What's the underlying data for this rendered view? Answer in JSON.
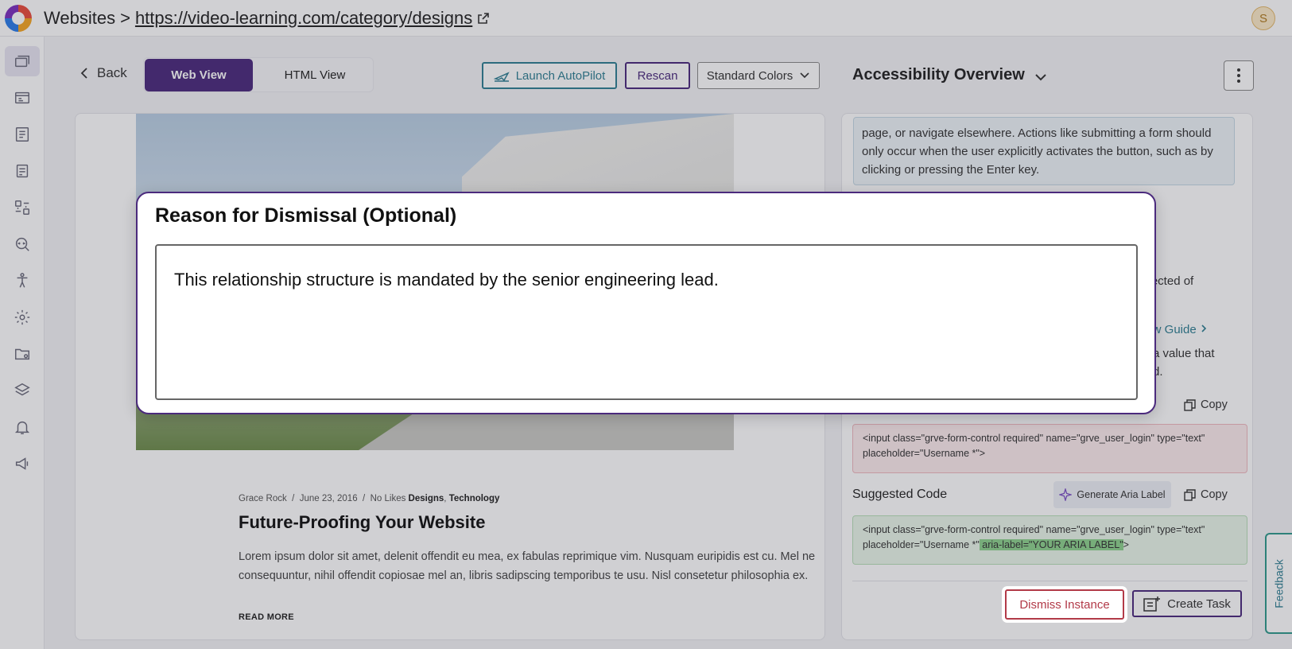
{
  "header": {
    "section": "Websites",
    "separator": ">",
    "url": "https://video-learning.com/category/designs",
    "avatar_initial": "S"
  },
  "sidebar": {
    "items": [
      {
        "icon": "pages-icon",
        "active": true
      },
      {
        "icon": "id-card-icon"
      },
      {
        "icon": "report-icon"
      },
      {
        "icon": "document-icon"
      },
      {
        "icon": "scan-icon"
      },
      {
        "icon": "search-code-icon"
      },
      {
        "icon": "accessibility-icon"
      },
      {
        "icon": "gear-icon"
      },
      {
        "icon": "folder-icon"
      },
      {
        "icon": "layers-icon"
      },
      {
        "icon": "bell-icon"
      },
      {
        "icon": "megaphone-icon"
      }
    ]
  },
  "toolbar": {
    "back_label": "Back",
    "web_view_label": "Web View",
    "html_view_label": "HTML View",
    "autopilot_label": "Launch AutoPilot",
    "rescan_label": "Rescan",
    "colors_label": "Standard Colors"
  },
  "preview": {
    "meta_author": "Grace Rock",
    "meta_sep": "/",
    "meta_date": "June 23, 2016",
    "meta_likes": "No Likes",
    "meta_cat1": "Designs",
    "meta_comma": ",",
    "meta_cat2": "Technology",
    "post_title": "Future-Proofing Your Website",
    "body_line1": "Lorem ipsum dolor sit amet, delenit offendit eu mea, ex fabulas reprimique vim. Nusquam euripidis est cu. Mel ne",
    "body_line2": "consequuntur, nihil offendit copiosae mel an, libris sadipscing temporibus te usu. Nisl consetetur philosophia ex.",
    "read_more": "READ MORE"
  },
  "panel": {
    "title": "Accessibility Overview",
    "description": "page, or navigate elsewhere. Actions like submitting a form should only occur when the user explicitly activates the button, such as by clicking or pressing the Enter key.",
    "fragment_expected": "xpected of",
    "view_guide": "iew Guide",
    "fragment_value": "a value that",
    "fragment_d": "d.",
    "copy_label": "Copy",
    "bad_code": "<input class=\"grve-form-control required\" name=\"grve_user_login\" type=\"text\" placeholder=\"Username *\">",
    "suggested_label": "Suggested Code",
    "generate_label": "Generate Aria Label",
    "good_code_main": "<input class=\"grve-form-control required\" name=\"grve_user_login\" type=\"text\" placeholder=\"Username *\"",
    "good_code_highlight": " aria-label=\"YOUR ARIA LABEL\"",
    "good_code_end": ">",
    "dismiss_label": "Dismiss Instance",
    "create_task_label": "Create Task",
    "feedback_label": "Feedback"
  },
  "modal": {
    "title": "Reason for Dismissal (Optional)",
    "reason_value": "This relationship structure is mandated by the senior engineering lead."
  },
  "colors": {
    "brand_purple": "#4b2a7d",
    "teal": "#2f7f93",
    "danger": "#b23a48"
  }
}
